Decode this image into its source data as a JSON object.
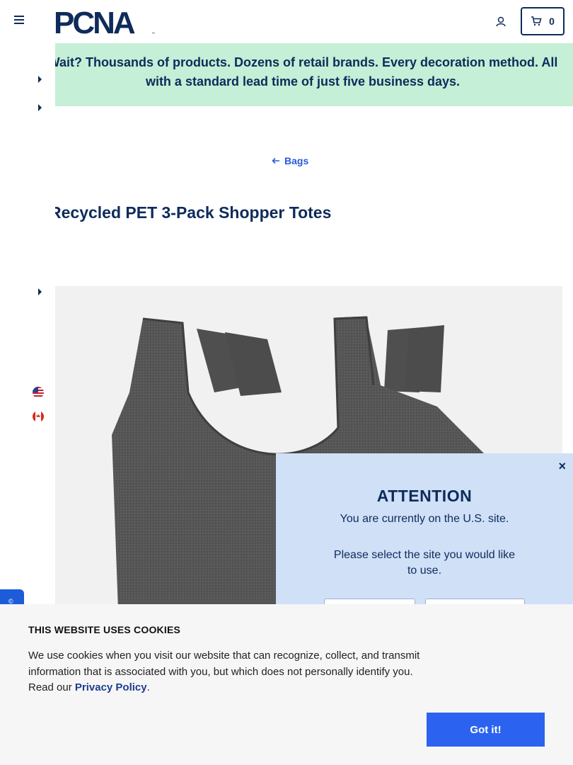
{
  "header": {
    "cart_count": "0"
  },
  "banner": {
    "text": "Wait? Thousands of products. Dozens of retail brands. Every decoration method. All with a standard lead time of just five business days."
  },
  "breadcrumb": {
    "back_label": "Bags"
  },
  "product": {
    "title": "Recycled PET 3-Pack Shopper Totes"
  },
  "attention": {
    "close": "×",
    "title": "ATTENTION",
    "message": "You are currently on the U.S. site.",
    "prompt": "Please select the site you would like to use."
  },
  "cookies": {
    "title": "THIS WEBSITE USES COOKIES",
    "text_before": "We use cookies when you visit our website that can recognize, collect, and transmit information that is associated with you, but which does not personally identify you. Read our ",
    "link": "Privacy Policy",
    "text_after": ".",
    "button": "Got it!"
  },
  "colors": {
    "brand_navy": "#0f2b5b",
    "banner_green": "#c5efd6",
    "accent_blue": "#2b63f0",
    "attention_bg": "#cfe0f7"
  }
}
